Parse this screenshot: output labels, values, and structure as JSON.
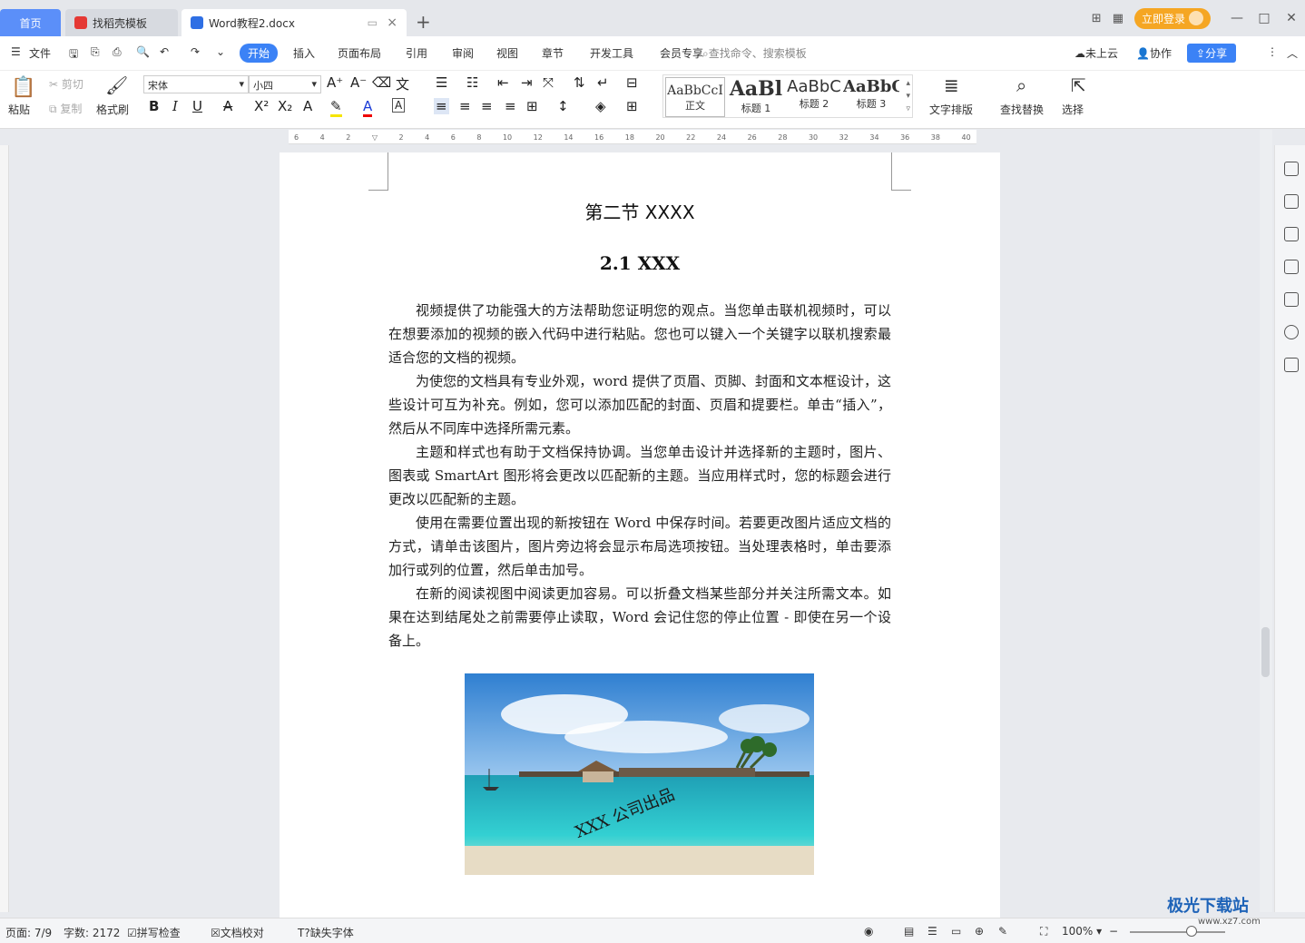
{
  "tabs": {
    "home": "首页",
    "template": "找稻壳模板",
    "document": "Word教程2.docx",
    "add": "+",
    "close": "×"
  },
  "titlebar": {
    "login": "立即登录",
    "minimize": "—",
    "maximize": "□",
    "close": "✕"
  },
  "menu": {
    "file": "文件",
    "items": [
      "开始",
      "插入",
      "页面布局",
      "引用",
      "审阅",
      "视图",
      "章节",
      "开发工具",
      "会员专享"
    ],
    "search_placeholder": "查找命令、搜索模板",
    "cloud": "未上云",
    "collab": "协作",
    "share": "分享"
  },
  "ribbon": {
    "paste": "粘贴",
    "cut": "剪切",
    "copy": "复制",
    "format_painter": "格式刷",
    "font_name": "宋体",
    "font_size": "小四",
    "styles": [
      {
        "sample": "AaBbCcI",
        "label": "正文"
      },
      {
        "sample": "AaBl",
        "label": "标题 1"
      },
      {
        "sample": "AaBbC",
        "label": "标题 2"
      },
      {
        "sample": "AaBbC",
        "label": "标题 3"
      }
    ],
    "text_layout": "文字排版",
    "find_replace": "查找替换",
    "select": "选择"
  },
  "ruler": {
    "ticks": [
      "6",
      "4",
      "2",
      "",
      "2",
      "4",
      "6",
      "8",
      "10",
      "12",
      "14",
      "16",
      "18",
      "20",
      "22",
      "24",
      "26",
      "28",
      "30",
      "32",
      "34",
      "36",
      "38",
      "40"
    ]
  },
  "document": {
    "heading2": "第二节  XXXX",
    "heading3": "2.1 XXX",
    "paragraphs": [
      "视频提供了功能强大的方法帮助您证明您的观点。当您单击联机视频时，可以在想要添加的视频的嵌入代码中进行粘贴。您也可以键入一个关键字以联机搜索最适合您的文档的视频。",
      "为使您的文档具有专业外观，word 提供了页眉、页脚、封面和文本框设计，这些设计可互为补充。例如，您可以添加匹配的封面、页眉和提要栏。单击“插入”，然后从不同库中选择所需元素。",
      "主题和样式也有助于文档保持协调。当您单击设计并选择新的主题时，图片、图表或 SmartArt 图形将会更改以匹配新的主题。当应用样式时，您的标题会进行更改以匹配新的主题。",
      "使用在需要位置出现的新按钮在 Word 中保存时间。若要更改图片适应文档的方式，请单击该图片，图片旁边将会显示布局选项按钮。当处理表格时，单击要添加行或列的位置，然后单击加号。",
      "在新的阅读视图中阅读更加容易。可以折叠文档某些部分并关注所需文本。如果在达到结尾处之前需要停止读取，Word 会记住您的停止位置 - 即使在另一个设备上。"
    ],
    "image_watermark": "XXX 公司出品"
  },
  "status": {
    "page": "页面: 7/9",
    "words": "字数: 2172",
    "spell": "拼写检查",
    "proof": "文档校对",
    "missing_font": "缺失字体",
    "zoom": "100%"
  },
  "watermark": {
    "brand": "极光下载站",
    "url": "www.xz7.com"
  },
  "colors": {
    "accent": "#3b82f6",
    "login": "#f5a623",
    "home_tab": "#5b8ff9"
  }
}
